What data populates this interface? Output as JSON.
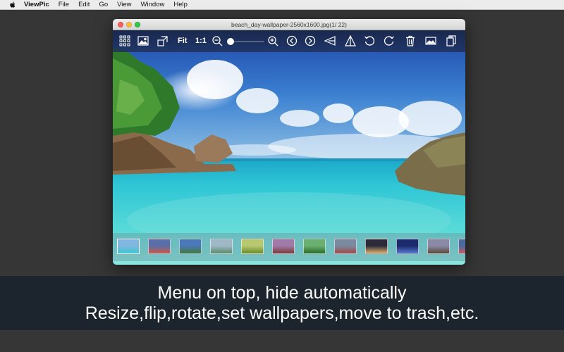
{
  "menubar": {
    "app_name": "ViewPic",
    "items": [
      "File",
      "Edit",
      "Go",
      "View",
      "Window",
      "Help"
    ]
  },
  "window": {
    "title": "beach_day-wallpaper-2560x1600.jpg(1/ 22)"
  },
  "toolbar": {
    "fit_label": "Fit",
    "actual_size_label": "1:1",
    "zoom_level": 0.0,
    "icons": [
      "grid-view-icon",
      "single-image-icon",
      "resize-icon",
      "zoom-out-icon",
      "zoom-in-icon",
      "previous-icon",
      "next-icon",
      "flip-horizontal-icon",
      "flip-vertical-icon",
      "rotate-left-icon",
      "rotate-right-icon",
      "trash-icon",
      "set-wallpaper-icon",
      "info-icon"
    ]
  },
  "thumbnails": [
    {
      "name": "thumb-1",
      "colors": [
        "#7fb7e0",
        "#3ec7d0"
      ]
    },
    {
      "name": "thumb-2",
      "colors": [
        "#5a6ea8",
        "#c85a4a"
      ]
    },
    {
      "name": "thumb-3",
      "colors": [
        "#4a78b8",
        "#3f7a3a"
      ]
    },
    {
      "name": "thumb-4",
      "colors": [
        "#9fb8c8",
        "#5a8a6a"
      ]
    },
    {
      "name": "thumb-5",
      "colors": [
        "#b8c870",
        "#6a8a2a"
      ]
    },
    {
      "name": "thumb-6",
      "colors": [
        "#a07aa8",
        "#7a3a3a"
      ]
    },
    {
      "name": "thumb-7",
      "colors": [
        "#6ab070",
        "#2a6a2a"
      ]
    },
    {
      "name": "thumb-8",
      "colors": [
        "#7a8aa0",
        "#a04a4a"
      ]
    },
    {
      "name": "thumb-9",
      "colors": [
        "#2a2a3a",
        "#e0b070"
      ]
    },
    {
      "name": "thumb-10",
      "colors": [
        "#1a2a6a",
        "#5a7ad0"
      ]
    },
    {
      "name": "thumb-11",
      "colors": [
        "#8a8aa8",
        "#5a4a3a"
      ]
    },
    {
      "name": "thumb-12",
      "colors": [
        "#4a6aa0",
        "#c06060"
      ]
    }
  ],
  "caption": {
    "line1": "Menu on top, hide automatically",
    "line2": "Resize,flip,rotate,set wallpapers,move to trash,etc."
  },
  "colors": {
    "desktop": "#363636",
    "caption_bg": "#1c242d",
    "toolbar_bg": "#1a2646",
    "water": "#3ecfd6"
  }
}
